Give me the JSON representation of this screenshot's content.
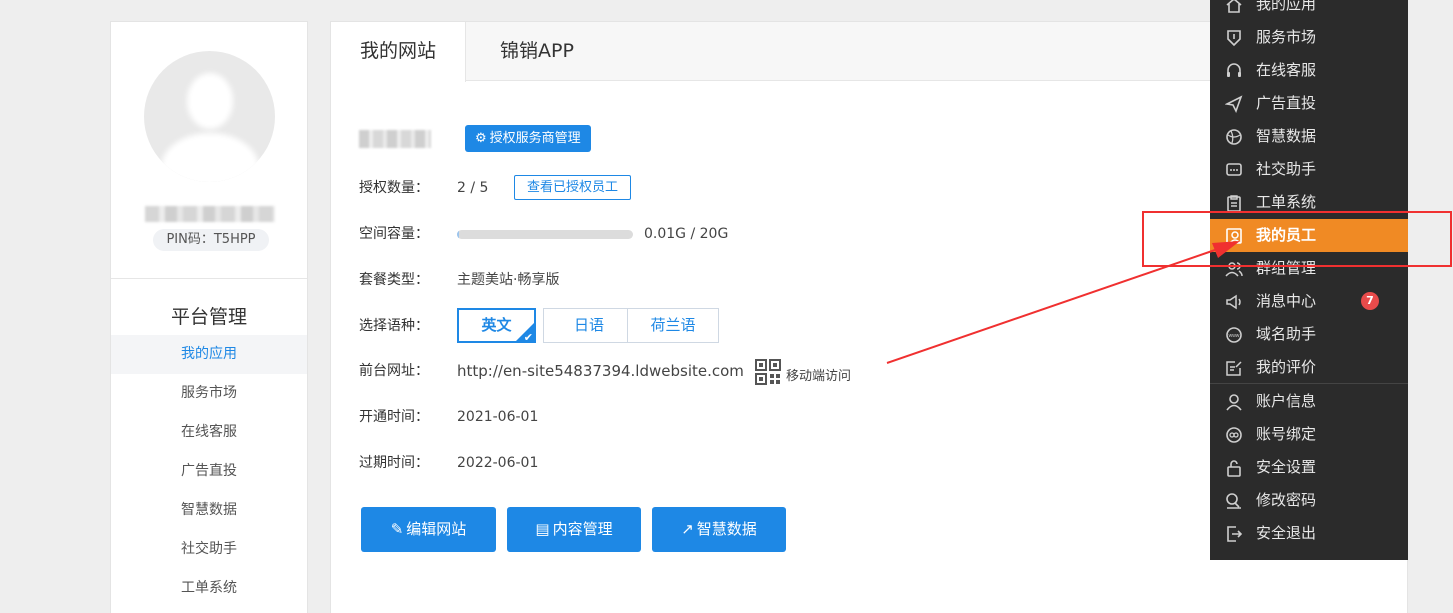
{
  "profile": {
    "pin": "PIN码：T5HPP",
    "platform_title": "平台管理",
    "nav": [
      {
        "label": "我的应用",
        "active": true
      },
      {
        "label": "服务市场"
      },
      {
        "label": "在线客服"
      },
      {
        "label": "广告直投"
      },
      {
        "label": "智慧数据"
      },
      {
        "label": "社交助手"
      },
      {
        "label": "工单系统"
      }
    ]
  },
  "tabs": [
    "我的网站",
    "锦销APP"
  ],
  "site": {
    "auth_button": "授权服务商管理",
    "auth_count_label": "授权数量：",
    "auth_count_value": "2 / 5",
    "view_staff_button": "查看已授权员工",
    "space_label": "空间容量：",
    "space_value": "0.01G / 20G",
    "space_fraction": 0.0005,
    "plan_label": "套餐类型：",
    "plan_value": "主题美站·畅享版",
    "lang_label": "选择语种：",
    "languages": [
      {
        "label": "英文",
        "selected": true
      },
      {
        "label": "日语"
      },
      {
        "label": "荷兰语"
      }
    ],
    "url_label": "前台网址：",
    "url_value": "http://en-site54837394.ldwebsite.com",
    "mobile_label": "移动端访问",
    "open_label": "开通时间：",
    "open_value": "2021-06-01",
    "expire_label": "过期时间：",
    "expire_value": "2022-06-01",
    "actions": [
      "编辑网站",
      "内容管理",
      "智慧数据"
    ]
  },
  "menu": {
    "items": [
      {
        "label": "我的应用",
        "icon": "home-icon"
      },
      {
        "label": "服务市场",
        "icon": "shield-icon"
      },
      {
        "label": "在线客服",
        "icon": "headset-icon"
      },
      {
        "label": "广告直投",
        "icon": "send-icon"
      },
      {
        "label": "智慧数据",
        "icon": "globe-icon"
      },
      {
        "label": "社交助手",
        "icon": "chat-icon"
      },
      {
        "label": "工单系统",
        "icon": "clipboard-icon"
      },
      {
        "label": "我的员工",
        "icon": "staff-icon",
        "active": true
      },
      {
        "label": "群组管理",
        "icon": "group-icon"
      },
      {
        "label": "消息中心",
        "icon": "megaphone-icon",
        "badge": "7"
      },
      {
        "label": "域名助手",
        "icon": "www-icon"
      },
      {
        "label": "我的评价",
        "icon": "review-icon"
      },
      {
        "label": "账户信息",
        "icon": "user-icon"
      },
      {
        "label": "账号绑定",
        "icon": "link-icon"
      },
      {
        "label": "安全设置",
        "icon": "lock-icon"
      },
      {
        "label": "修改密码",
        "icon": "edit-key-icon"
      },
      {
        "label": "安全退出",
        "icon": "logout-icon"
      }
    ]
  },
  "colors": {
    "primary": "#1e88e5",
    "menu_bg": "#2b2b2b",
    "menu_active": "#f08a24",
    "annotation": "#f03030",
    "badge": "#e84b4b"
  }
}
